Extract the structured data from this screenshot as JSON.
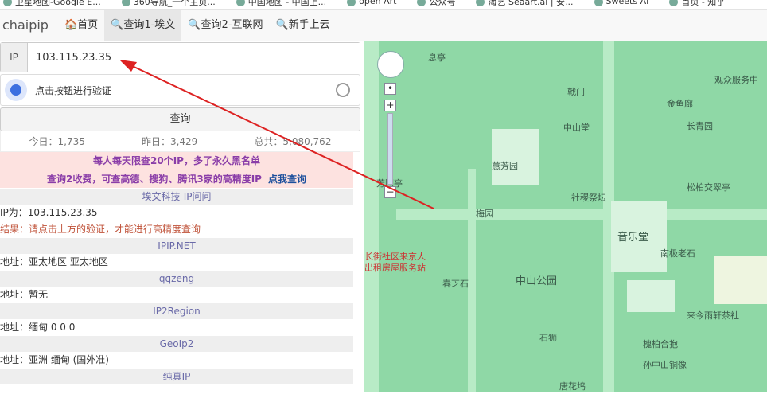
{
  "bookmarks": [
    "卫星地图-Google E...",
    "360导航_一个主页...",
    "中国地图 - 中国上...",
    "open Art",
    "公众号",
    "海艺 Seaart.ai | 安...",
    "Sweets AI",
    "首页 - 知乎"
  ],
  "nav": {
    "brand": "chaipip",
    "items": [
      "🏠首页",
      "🔍查询1-埃文",
      "🔍查询2-互联网",
      "🔍新手上云"
    ]
  },
  "ip": {
    "label": "IP",
    "value": "103.115.23.35"
  },
  "captcha": {
    "text": "点击按钮进行验证"
  },
  "query_button": "查询",
  "stats": {
    "today": "今日：1,735",
    "yesterday": "昨日：3,429",
    "total": "总共：5,080,762"
  },
  "warnings": {
    "line1": "每人每天限查20个IP，多了永久黑名单",
    "line2": "查询2收费，可查高德、搜狗、腾讯3家的高精度IP",
    "link": "点我查询"
  },
  "results": [
    {
      "header": "埃文科技-IP问问",
      "rows": [
        "IP为：103.115.23.35"
      ],
      "red": "结果：请点击上方的验证，才能进行高精度查询"
    },
    {
      "header": "IPIP.NET",
      "rows": [
        "地址：亚太地区 亚太地区"
      ]
    },
    {
      "header": "qqzeng",
      "rows": [
        "地址：暂无"
      ]
    },
    {
      "header": "IP2Region",
      "rows": [
        "地址：缅甸 0 0 0"
      ]
    },
    {
      "header": "GeoIp2",
      "rows": [
        "地址：亚洲 缅甸 (国外准)"
      ]
    },
    {
      "header": "纯真IP",
      "rows": []
    }
  ],
  "map": {
    "labels": [
      "息亭",
      "观众服务中",
      "戟门",
      "金鱼廊",
      "长青园",
      "中山堂",
      "蕙芳园",
      "松柏交翠亭",
      "芳园亭",
      "社稷祭坛",
      "梅园",
      "音乐堂",
      "南极老石",
      "长街社区来京人",
      "出租房屋服务站",
      "中山公园",
      "来今雨轩茶社",
      "石狮",
      "槐柏合抱",
      "孙中山铜像",
      "唐花坞",
      "春芝石"
    ]
  }
}
